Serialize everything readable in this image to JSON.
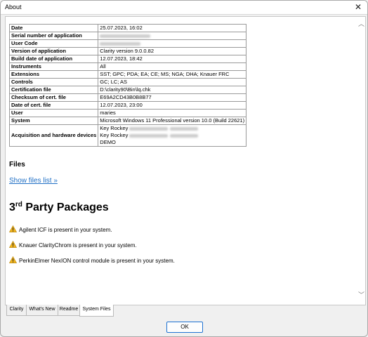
{
  "window": {
    "title": "About",
    "close_glyph": "✕"
  },
  "info_table": {
    "rows": [
      {
        "key": "Date",
        "value": "25.07.2023, 16:02"
      },
      {
        "key": "Serial number of application",
        "value": ""
      },
      {
        "key": "User Code",
        "value": ""
      },
      {
        "key": "Version of application",
        "value": "Clarity version 9.0.0.82"
      },
      {
        "key": "Build date of application",
        "value": "12.07.2023, 18:42"
      },
      {
        "key": "Instruments",
        "value": "All"
      },
      {
        "key": "Extensions",
        "value": "SST; GPC; PDA; EA; CE; MS; NGA; DHA; Knauer FRC"
      },
      {
        "key": "Controls",
        "value": "GC; LC; AS"
      },
      {
        "key": "Certification file",
        "value": "D:\\clarity90\\Bin\\lq.chk"
      },
      {
        "key": "Checksum of cert. file",
        "value": "E69A2CD43B0B8B77"
      },
      {
        "key": "Date of cert. file",
        "value": "12.07.2023, 23:00"
      },
      {
        "key": "User",
        "value": "maries"
      },
      {
        "key": "System",
        "value": "Microsoft Windows 11 Professional version 10.0 (Build 22621)"
      },
      {
        "key": "Acquisition and hardware devices",
        "value_lines": [
          "Key Rockey",
          "Key Rockey",
          "DEMO"
        ]
      }
    ]
  },
  "files": {
    "heading": "Files",
    "link": "Show files list »"
  },
  "third_party": {
    "heading_prefix": "3",
    "heading_sup": "rd",
    "heading_suffix": " Party Packages",
    "packages": [
      "Agilent ICF is present in your system.",
      "Knauer ClarityChrom is present in your system.",
      "PerkinElmer NexION control module is present in your system."
    ],
    "warning_icon": "warning-icon"
  },
  "tabs": [
    "Clarity",
    "What's New",
    "Readme",
    "System Files"
  ],
  "active_tab": "System Files",
  "ok_label": "OK"
}
